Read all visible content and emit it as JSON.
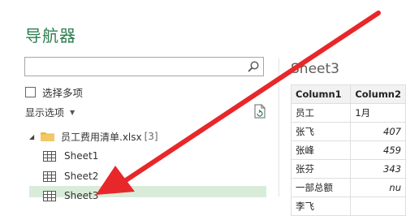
{
  "navigator": {
    "title": "导航器",
    "search": {
      "value": "",
      "placeholder": ""
    },
    "multi_select_label": "选择多项",
    "display_options_label": "显示选项",
    "tree": {
      "file_name": "员工费用清单.xlsx",
      "file_count": "[3]",
      "items": [
        {
          "label": "Sheet1"
        },
        {
          "label": "Sheet2"
        },
        {
          "label": "Sheet3"
        }
      ]
    }
  },
  "preview": {
    "title": "Sheet3",
    "headers": [
      "Column1",
      "Column2"
    ],
    "rows": [
      [
        "员工",
        "1月"
      ],
      [
        "张飞",
        "407"
      ],
      [
        "张峰",
        "459"
      ],
      [
        "张芬",
        "343"
      ],
      [
        "一部总额",
        "nu"
      ],
      [
        "李飞",
        ""
      ]
    ]
  },
  "colors": {
    "accent_green": "#2d7d4f",
    "selected_row": "#d9ecd9",
    "annotation_arrow": "#e8272a"
  },
  "icons": [
    "search-icon",
    "refresh-icon",
    "folder-icon",
    "sheet-icon",
    "expand-arrow-icon",
    "dropdown-caret-icon"
  ]
}
